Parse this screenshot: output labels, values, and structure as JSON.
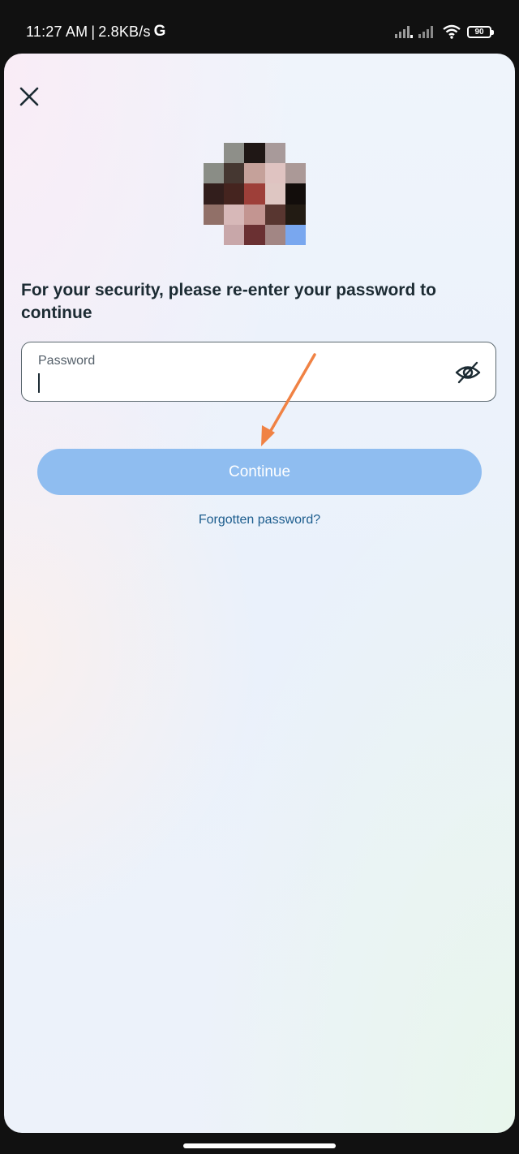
{
  "status_bar": {
    "time": "11:27 AM",
    "separator": "|",
    "network_speed": "2.8KB/s",
    "app_indicator": "G",
    "battery_level": "90",
    "icons": [
      "signal-icon",
      "signal-icon",
      "wifi-icon",
      "battery-icon"
    ]
  },
  "reauth": {
    "close_icon": "close-icon",
    "heading": "For your security, please re-enter your password to continue",
    "password_field": {
      "label": "Password",
      "value": "",
      "visibility_icon": "eye-off-icon"
    },
    "continue_label": "Continue",
    "forgot_label": "Forgotten password?"
  },
  "colors": {
    "button_bg": "#8fbdf0",
    "link": "#1b5c8d",
    "heading": "#1c2b33",
    "annotation_arrow": "#f08244"
  },
  "avatar_pixels": [
    [
      "transparent",
      "#8e8f89",
      "#1f1715",
      "#a89a9a",
      "transparent"
    ],
    [
      "#8a8d86",
      "#453731",
      "#c5a19a",
      "#dfc3c1",
      "#ab9997"
    ],
    [
      "#321e1c",
      "#45241f",
      "#9e3f39",
      "#dec6c2",
      "#120d0b"
    ],
    [
      "#917068",
      "#d7b8b8",
      "#c39591",
      "#583630",
      "#221b13"
    ],
    [
      "transparent",
      "#c8a7a9",
      "#6a3032",
      "#a28684",
      "#79a7ef"
    ]
  ]
}
